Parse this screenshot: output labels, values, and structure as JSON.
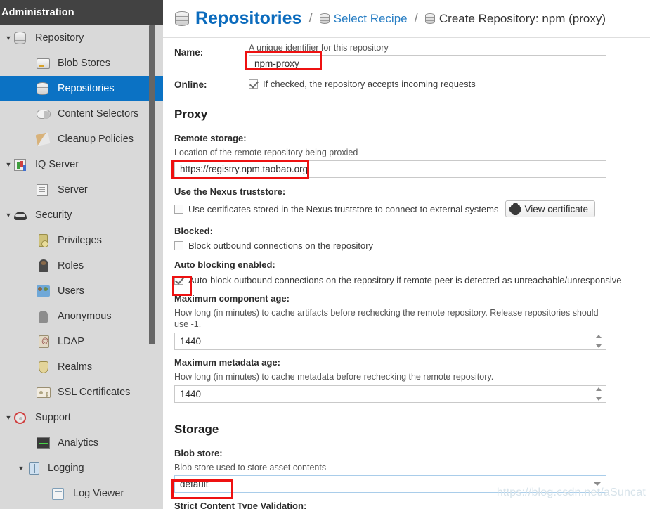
{
  "sidebar": {
    "header": "Administration",
    "items": [
      {
        "label": "Repository",
        "icon": "database-icon",
        "level": 0,
        "twisty": "down",
        "selected": false
      },
      {
        "label": "Blob Stores",
        "icon": "blob-store-icon",
        "level": 1,
        "twisty": "none",
        "selected": false
      },
      {
        "label": "Repositories",
        "icon": "database-icon",
        "level": 1,
        "twisty": "none",
        "selected": true
      },
      {
        "label": "Content Selectors",
        "icon": "content-selector-icon",
        "level": 1,
        "twisty": "none",
        "selected": false
      },
      {
        "label": "Cleanup Policies",
        "icon": "broom-icon",
        "level": 1,
        "twisty": "none",
        "selected": false
      },
      {
        "label": "IQ Server",
        "icon": "iq-server-icon",
        "level": 0,
        "twisty": "down",
        "selected": false
      },
      {
        "label": "Server",
        "icon": "server-icon",
        "level": 1,
        "twisty": "none",
        "selected": false
      },
      {
        "label": "Security",
        "icon": "security-badge-icon",
        "level": 0,
        "twisty": "down",
        "selected": false
      },
      {
        "label": "Privileges",
        "icon": "privileges-icon",
        "level": 1,
        "twisty": "none",
        "selected": false
      },
      {
        "label": "Roles",
        "icon": "roles-icon",
        "level": 1,
        "twisty": "none",
        "selected": false
      },
      {
        "label": "Users",
        "icon": "users-icon",
        "level": 1,
        "twisty": "none",
        "selected": false
      },
      {
        "label": "Anonymous",
        "icon": "anonymous-icon",
        "level": 1,
        "twisty": "none",
        "selected": false
      },
      {
        "label": "LDAP",
        "icon": "ldap-icon",
        "level": 1,
        "twisty": "none",
        "selected": false
      },
      {
        "label": "Realms",
        "icon": "realms-shield-icon",
        "level": 1,
        "twisty": "none",
        "selected": false
      },
      {
        "label": "SSL Certificates",
        "icon": "ssl-certificate-icon",
        "level": 1,
        "twisty": "none",
        "selected": false
      },
      {
        "label": "Support",
        "icon": "support-lifering-icon",
        "level": 0,
        "twisty": "down",
        "selected": false
      },
      {
        "label": "Analytics",
        "icon": "analytics-icon",
        "level": 1,
        "twisty": "none",
        "selected": false
      },
      {
        "label": "Logging",
        "icon": "logging-book-icon",
        "level": 1,
        "twisty": "down",
        "selected": false
      },
      {
        "label": "Log Viewer",
        "icon": "log-viewer-icon",
        "level": 2,
        "twisty": "none",
        "selected": false
      }
    ]
  },
  "breadcrumb": {
    "title": "Repositories",
    "separator": "/",
    "link": "Select Recipe",
    "current": "Create Repository: npm (proxy)"
  },
  "form": {
    "name": {
      "label": "Name:",
      "hint": "A unique identifier for this repository",
      "value": "npm-proxy"
    },
    "online": {
      "label": "Online:",
      "checkbox_text": "If checked, the repository accepts incoming requests",
      "checked": true
    },
    "proxy_section": {
      "title": "Proxy",
      "remote_storage": {
        "label": "Remote storage:",
        "hint": "Location of the remote repository being proxied",
        "value": "https://registry.npm.taobao.org"
      },
      "truststore": {
        "label": "Use the Nexus truststore:",
        "checkbox_text": "Use certificates stored in the Nexus truststore to connect to external systems",
        "checked": false,
        "button_label": "View certificate"
      },
      "blocked": {
        "label": "Blocked:",
        "checkbox_text": "Block outbound connections on the repository",
        "checked": false
      },
      "auto_blocking": {
        "label": "Auto blocking enabled:",
        "checkbox_text": "Auto-block outbound connections on the repository if remote peer is detected as unreachable/unresponsive",
        "checked": true
      },
      "max_component_age": {
        "label": "Maximum component age:",
        "hint": "How long (in minutes) to cache artifacts before rechecking the remote repository. Release repositories should use -1.",
        "value": "1440"
      },
      "max_metadata_age": {
        "label": "Maximum metadata age:",
        "hint": "How long (in minutes) to cache metadata before rechecking the remote repository.",
        "value": "1440"
      }
    },
    "storage_section": {
      "title": "Storage",
      "blob_store": {
        "label": "Blob store:",
        "hint": "Blob store used to store asset contents",
        "value": "default"
      },
      "strict_content": {
        "label": "Strict Content Type Validation:"
      }
    }
  },
  "watermark": "https://blog.csdn.net/aSuncat",
  "colors": {
    "selected_nav": "#0b72c4",
    "breadcrumb_title": "#0b6bbd",
    "annotation_red": "#ee1111",
    "sidebar_bg": "#d9d9d9",
    "sidebar_header_bg": "#424242"
  }
}
